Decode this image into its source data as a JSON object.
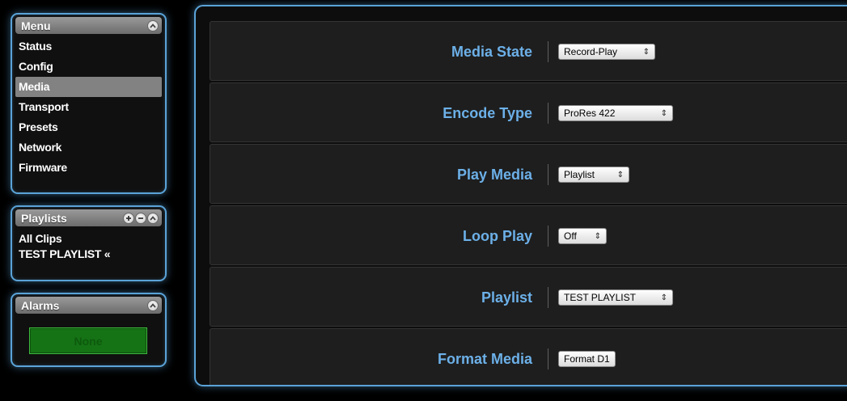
{
  "sidebar": {
    "menu": {
      "title": "Menu",
      "items": [
        {
          "label": "Status"
        },
        {
          "label": "Config"
        },
        {
          "label": "Media",
          "active": true
        },
        {
          "label": "Transport"
        },
        {
          "label": "Presets"
        },
        {
          "label": "Network"
        },
        {
          "label": "Firmware"
        }
      ]
    },
    "playlists": {
      "title": "Playlists",
      "items": [
        {
          "label": "All Clips"
        },
        {
          "label": "TEST PLAYLIST «"
        }
      ]
    },
    "alarms": {
      "title": "Alarms",
      "status": "None"
    }
  },
  "media": {
    "media_state": {
      "label": "Media State",
      "value": "Record-Play"
    },
    "encode_type": {
      "label": "Encode Type",
      "value": "ProRes 422"
    },
    "play_media": {
      "label": "Play Media",
      "value": "Playlist"
    },
    "loop_play": {
      "label": "Loop Play",
      "value": "Off"
    },
    "playlist": {
      "label": "Playlist",
      "value": "TEST PLAYLIST"
    },
    "format_media": {
      "label": "Format Media",
      "button_label": "Format D1"
    }
  },
  "icons": {
    "collapse": "chevron-up-icon",
    "add": "plus-icon",
    "remove": "minus-icon",
    "select_arrows": "updown-arrows-icon"
  },
  "colors": {
    "accent_border": "#5aa3d8",
    "label_blue": "#6cb0e8",
    "active_item": "#828282",
    "alarm_green": "#157315"
  }
}
